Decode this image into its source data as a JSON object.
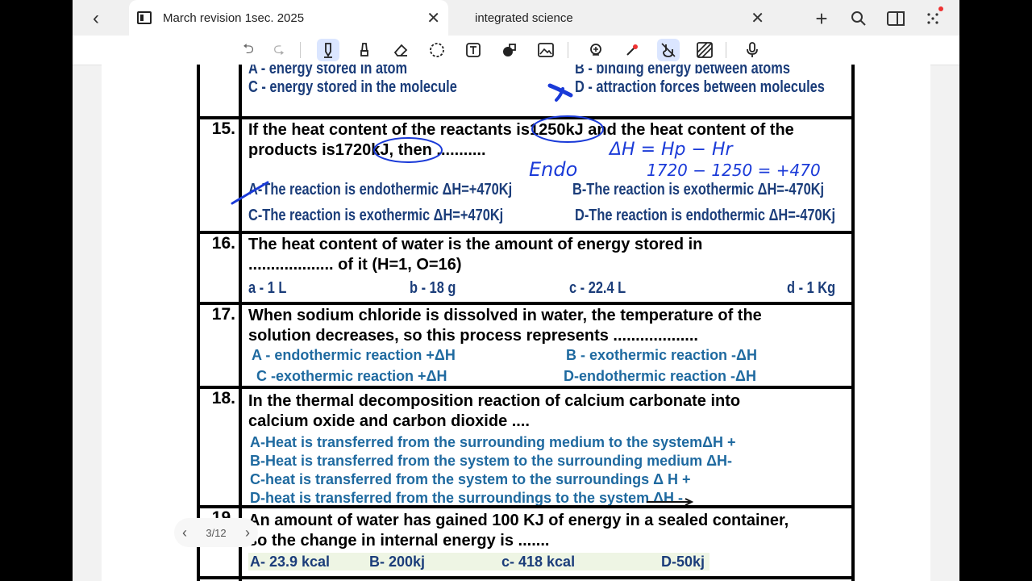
{
  "tabs": [
    {
      "title": "March revision 1sec. 2025"
    },
    {
      "title": "integrated science"
    }
  ],
  "toolbar": {
    "undo": "⮌",
    "redo": "⮎"
  },
  "pager": {
    "label": "3/12"
  },
  "q14": {
    "optC": "C - energy stored in the molecule",
    "optD": "D - attraction forces between molecules",
    "topA": "A - energy stored in atom",
    "topB": "B - binding energy between atoms"
  },
  "q15": {
    "num": "15.",
    "line1": "If the heat content of the reactants is1250kJ and the heat content of the",
    "line2": "products is1720kJ, then ...........",
    "optA": "A-The reaction is endothermic ΔH=+470Kj",
    "optB": "B-The reaction is exothermic  ΔH=-470Kj",
    "optC": "C-The reaction is exothermic   ΔH=+470Kj",
    "optD": "D-The reaction is endothermic  ΔH=-470Kj"
  },
  "q16": {
    "num": "16.",
    "line1": "The heat content of water is the amount of energy stored in",
    "line2": "................... of it (H=1, O=16)",
    "optA": "a - 1 L",
    "optB": "b - 18 g",
    "optC": "c - 22.4 L",
    "optD": "d - 1 Kg"
  },
  "q17": {
    "num": "17.",
    "line1": "When sodium chloride is dissolved in water, the temperature of the",
    "line2": "solution decreases, so this process represents ...................",
    "optA": "A - endothermic reaction +ΔH",
    "optB": "B - exothermic reaction   -ΔH",
    "optC": "C -exothermic reaction     +ΔH",
    "optD": "D-endothermic reaction -ΔH"
  },
  "q18": {
    "num": "18.",
    "line1": "In the thermal decomposition reaction of calcium carbonate into",
    "line2": "calcium oxide and carbon dioxide ....",
    "optA": "A-Heat is transferred from the surrounding medium to the systemΔH +",
    "optB": "B-Heat is transferred from the system to the surrounding medium  ΔH-",
    "optC": "C-heat is transferred from the system to the surroundings   Δ H +",
    "optD": "D-heat is transferred from the surroundings to the system    ΔH -"
  },
  "q19": {
    "num": "19.",
    "line1": "An amount of water has gained 100 KJ of energy in a sealed container,",
    "line2": "so the change in internal energy is .......",
    "optA": "A- 23.9 kcal",
    "optB": "B- 200kj",
    "optC": "c- 418 kcal",
    "optD": "D-50kj"
  },
  "ink": {
    "endo": "Endo",
    "formula1": "ΔH = Hp − Hr",
    "formula2": "1720 − 1250 = +470",
    "color": "#1a3ad8"
  }
}
